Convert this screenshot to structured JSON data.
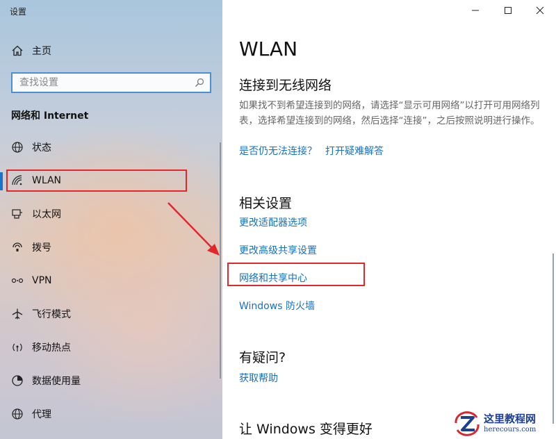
{
  "window": {
    "title": "设置",
    "controls": [
      "minimize-icon",
      "maximize-icon",
      "close-icon"
    ]
  },
  "sidebar": {
    "home_label": "主页",
    "search_placeholder": "查找设置",
    "section_title": "网络和 Internet",
    "selected": "WLAN",
    "items": [
      {
        "label": "状态",
        "icon": "globe-icon"
      },
      {
        "label": "WLAN",
        "icon": "wifi-icon"
      },
      {
        "label": "以太网",
        "icon": "ethernet-icon"
      },
      {
        "label": "拨号",
        "icon": "dialup-icon"
      },
      {
        "label": "VPN",
        "icon": "vpn-icon"
      },
      {
        "label": "飞行模式",
        "icon": "airplane-icon"
      },
      {
        "label": "移动热点",
        "icon": "hotspot-icon"
      },
      {
        "label": "数据使用量",
        "icon": "data-usage-icon"
      },
      {
        "label": "代理",
        "icon": "globe-icon"
      }
    ]
  },
  "main": {
    "page_title": "WLAN",
    "connect_heading": "连接到无线网络",
    "connect_text": "如果找不到希望连接到的网络，请选择“显示可用网络”以打开可用网络列表，选择希望连接到的网络，然后选择“连接”，之后按照说明进行操作。",
    "link_cant_connect": "是否仍无法连接？",
    "link_troubleshoot": "打开疑难解答",
    "related_heading": "相关设置",
    "related_links": [
      "更改适配器选项",
      "更改高级共享设置",
      "网络和共享中心",
      "Windows 防火墙"
    ],
    "question_heading": "有疑问?",
    "help_link": "获取帮助",
    "better_heading": "让 Windows 变得更好"
  },
  "annotations": {
    "highlight_color": "#e2262b",
    "accent": "#1670c3"
  },
  "watermark": {
    "cn": "这里教程网",
    "en": "herecours.com"
  }
}
